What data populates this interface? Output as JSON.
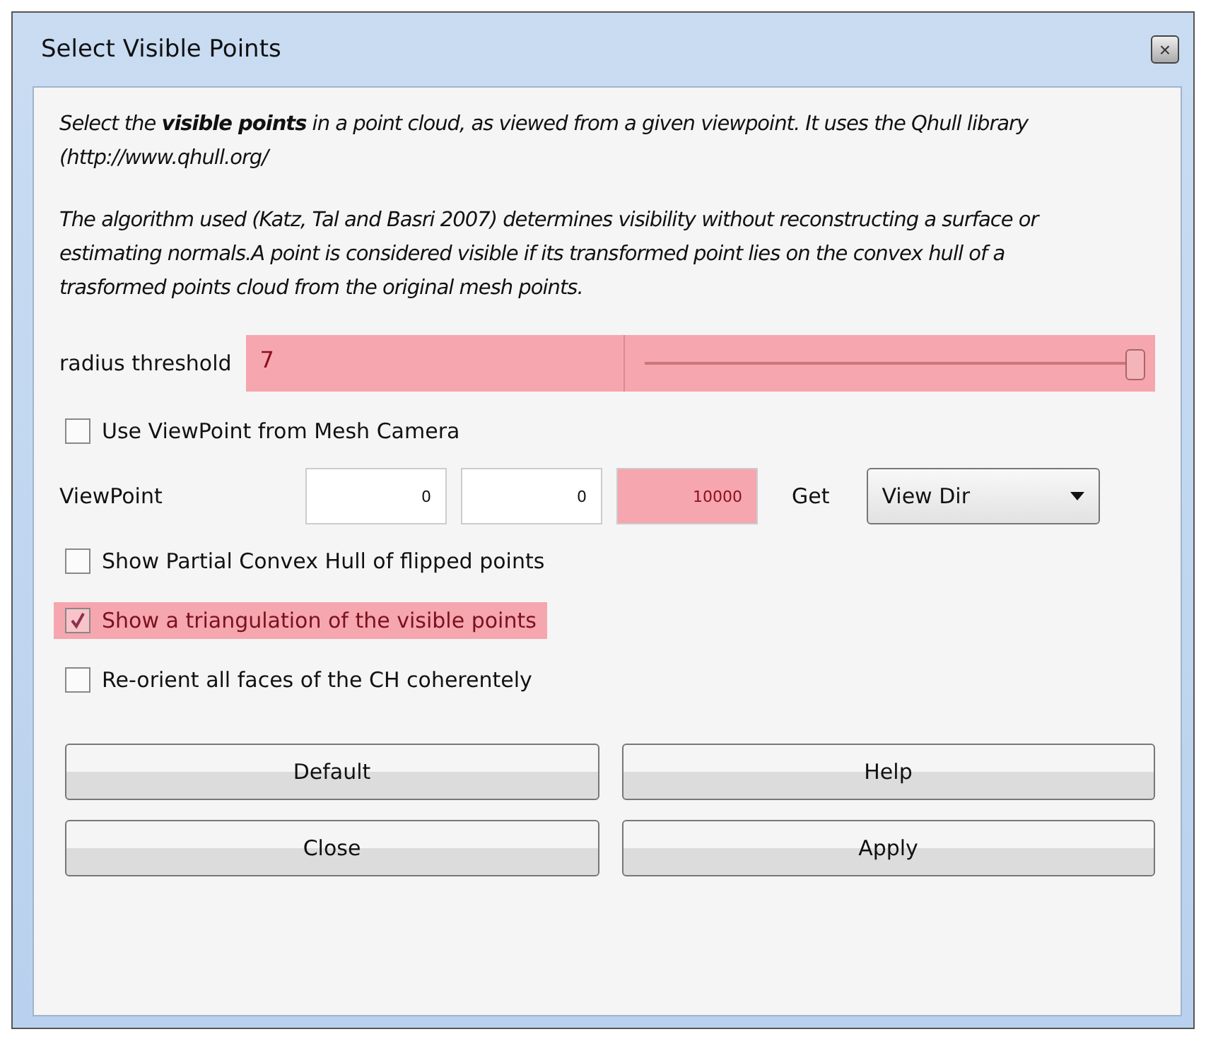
{
  "window": {
    "title": "Select Visible Points",
    "close": "×"
  },
  "description": [
    "Select the **visible points** in a point cloud, as viewed from a given viewpoint. It uses the Qhull library (http://www.qhull.org/",
    "The algorithm used (Katz, Tal and Basri 2007) determines visibility without reconstructing a surface or estimating normals.A point is considered visible if its transformed point lies on the convex hull of a trasformed points cloud from the original mesh points."
  ],
  "controls": [
    {
      "kind": "slider",
      "label": "radius threshold",
      "value": "7",
      "level": 1,
      "highlighted": true
    },
    {
      "kind": "checkbox",
      "label": "Use ViewPoint from Mesh Camera",
      "checked": false,
      "highlighted": false
    },
    {
      "kind": "vector",
      "label": "ViewPoint",
      "fields": [
        {
          "value": "0",
          "highlighted": false
        },
        {
          "value": "0",
          "highlighted": false
        },
        {
          "value": "10000",
          "highlighted": true
        }
      ],
      "get_label": "Get",
      "dropdown": "View Dir"
    },
    {
      "kind": "checkbox",
      "label": "Show Partial Convex Hull of flipped points",
      "checked": false,
      "highlighted": false
    },
    {
      "kind": "checkbox",
      "label": "Show a triangulation of the visible points",
      "checked": true,
      "highlighted": true
    },
    {
      "kind": "checkbox",
      "label": "Re-orient all faces of the CH coherentely",
      "checked": false,
      "highlighted": false
    }
  ],
  "buttons": [
    "Default",
    "Help",
    "Close",
    "Apply"
  ]
}
